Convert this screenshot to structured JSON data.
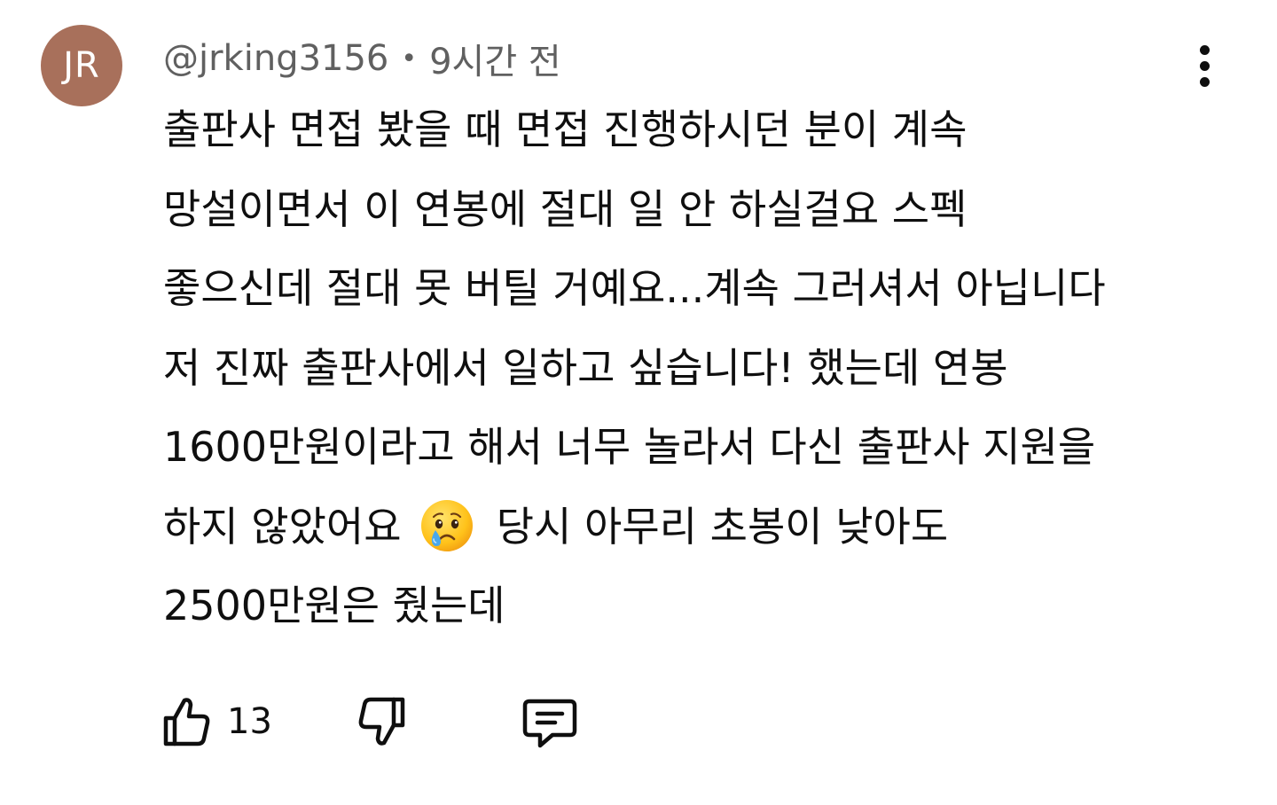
{
  "comment": {
    "avatar": {
      "initials": "JR",
      "color": "#a8705b"
    },
    "author_handle": "@jrking3156",
    "separator": "•",
    "timestamp": "9시간 전",
    "body_lines": [
      "출판사 면접 봤을 때 면접 진행하시던 분이 계속",
      "망설이면서 이 연봉에 절대 일 안 하실걸요 스펙",
      "좋으신데 절대 못 버틸 거예요...계속 그러셔서 아닙니다",
      "저 진짜 출판사에서 일하고 싶습니다! 했는데 연봉",
      "1600만원이라고 해서 너무 놀라서 다신 출판사 지원을",
      "하지 않았어요",
      "당시 아무리 초봉이 낮아도",
      "2500만원은 줬는데"
    ],
    "emoji_icon": "crying-face-icon",
    "like_count": "13",
    "icons": {
      "more": "more-vert-icon",
      "like": "thumbs-up-icon",
      "dislike": "thumbs-down-icon",
      "reply": "reply-comment-icon"
    }
  }
}
